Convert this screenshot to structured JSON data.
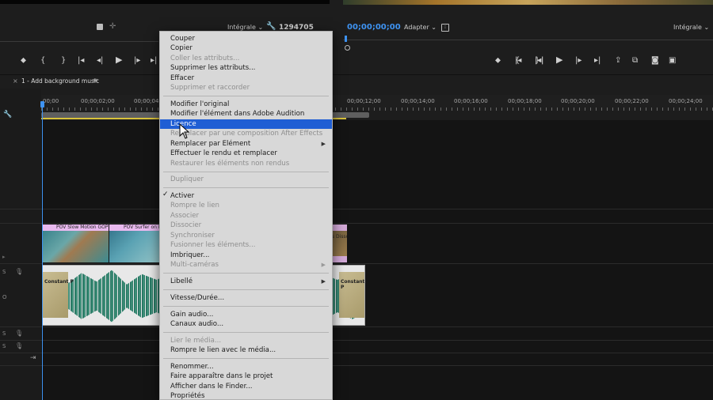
{
  "source_monitor": {
    "zoom": "Intégrale",
    "duration": "1294705"
  },
  "program_monitor": {
    "timecode": "00;00;00;00",
    "fit": "Adapter",
    "zoom": "Intégrale"
  },
  "sequence": {
    "tab_title": "1 - Add background music",
    "ruler_labels": [
      "00;00",
      "00;00;02;00",
      "00;00;04;00",
      "00;00;12;00",
      "00;00;14;00",
      "00;00;16;00",
      "00;00;18;00",
      "00;00;20;00",
      "00;00;22;00",
      "00;00;24;00"
    ]
  },
  "clips": {
    "video1": "POV Slow Motion GOPR",
    "video2": "POV Surfer on B",
    "video3": "s Disso",
    "audio_left": "Constant P",
    "audio_right": "Constant P"
  },
  "track_labels": [
    "S",
    "O",
    "S",
    "S"
  ],
  "context_menu": {
    "items": [
      {
        "label": "Couper"
      },
      {
        "label": "Copier"
      },
      {
        "label": "Coller les attributs..."
      },
      {
        "label": "Supprimer les attributs..."
      },
      {
        "label": "Effacer"
      },
      {
        "label": "Supprimer et raccorder"
      },
      {
        "label": "Modifier l'original"
      },
      {
        "label": "Modifier l'élément dans Adobe Audition"
      },
      {
        "label": "Licence"
      },
      {
        "label": "Remplacer par une composition After Effects"
      },
      {
        "label": "Remplacer par Elément"
      },
      {
        "label": "Effectuer le rendu et remplacer"
      },
      {
        "label": "Restaurer les éléments non rendus"
      },
      {
        "label": "Dupliquer"
      },
      {
        "label": "Activer"
      },
      {
        "label": "Rompre le lien"
      },
      {
        "label": "Associer"
      },
      {
        "label": "Dissocier"
      },
      {
        "label": "Synchroniser"
      },
      {
        "label": "Fusionner les éléments..."
      },
      {
        "label": "Imbriquer..."
      },
      {
        "label": "Multi-caméras"
      },
      {
        "label": "Libellé"
      },
      {
        "label": "Vitesse/Durée..."
      },
      {
        "label": "Gain audio..."
      },
      {
        "label": "Canaux audio..."
      },
      {
        "label": "Lier le média..."
      },
      {
        "label": "Rompre le lien avec le média..."
      },
      {
        "label": "Renommer..."
      },
      {
        "label": "Faire apparaître dans le projet"
      },
      {
        "label": "Afficher dans le Finder..."
      },
      {
        "label": "Propriétés"
      }
    ]
  },
  "colors": {
    "highlight": "#1f5ed4",
    "timecode": "#3e93f2",
    "video_clip_header": "#e9b9ef",
    "audio_wave": "#2b7a66"
  }
}
